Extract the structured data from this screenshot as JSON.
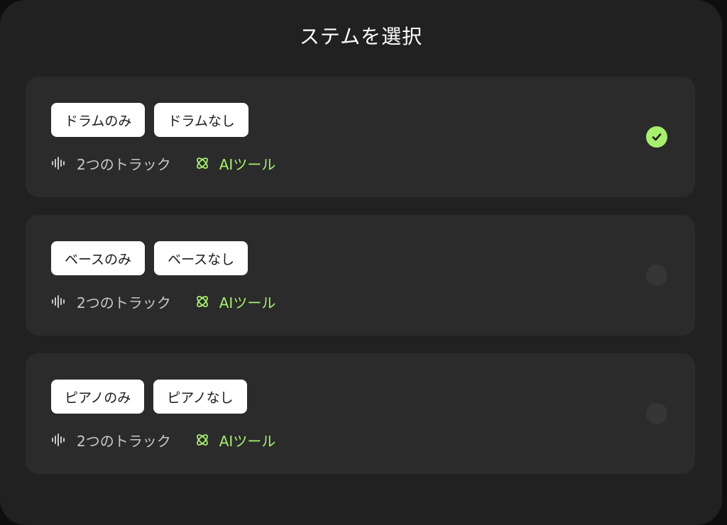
{
  "dialog": {
    "title": "ステムを選択"
  },
  "options": [
    {
      "chips": [
        "ドラムのみ",
        "ドラムなし"
      ],
      "tracks": "2つのトラック",
      "tag": "AIツール",
      "selected": true
    },
    {
      "chips": [
        "ベースのみ",
        "ベースなし"
      ],
      "tracks": "2つのトラック",
      "tag": "AIツール",
      "selected": false
    },
    {
      "chips": [
        "ピアノのみ",
        "ピアノなし"
      ],
      "tracks": "2つのトラック",
      "tag": "AIツール",
      "selected": false
    }
  ],
  "icons": {
    "tracks": "waveform-icon",
    "ai": "atom-icon",
    "selected": "check-circle-icon"
  },
  "colors": {
    "background": "#212121",
    "card": "#2b2b2b",
    "accent": "#a7ef6e",
    "chip": "#ffffff",
    "text_muted": "#c9c9c9"
  }
}
